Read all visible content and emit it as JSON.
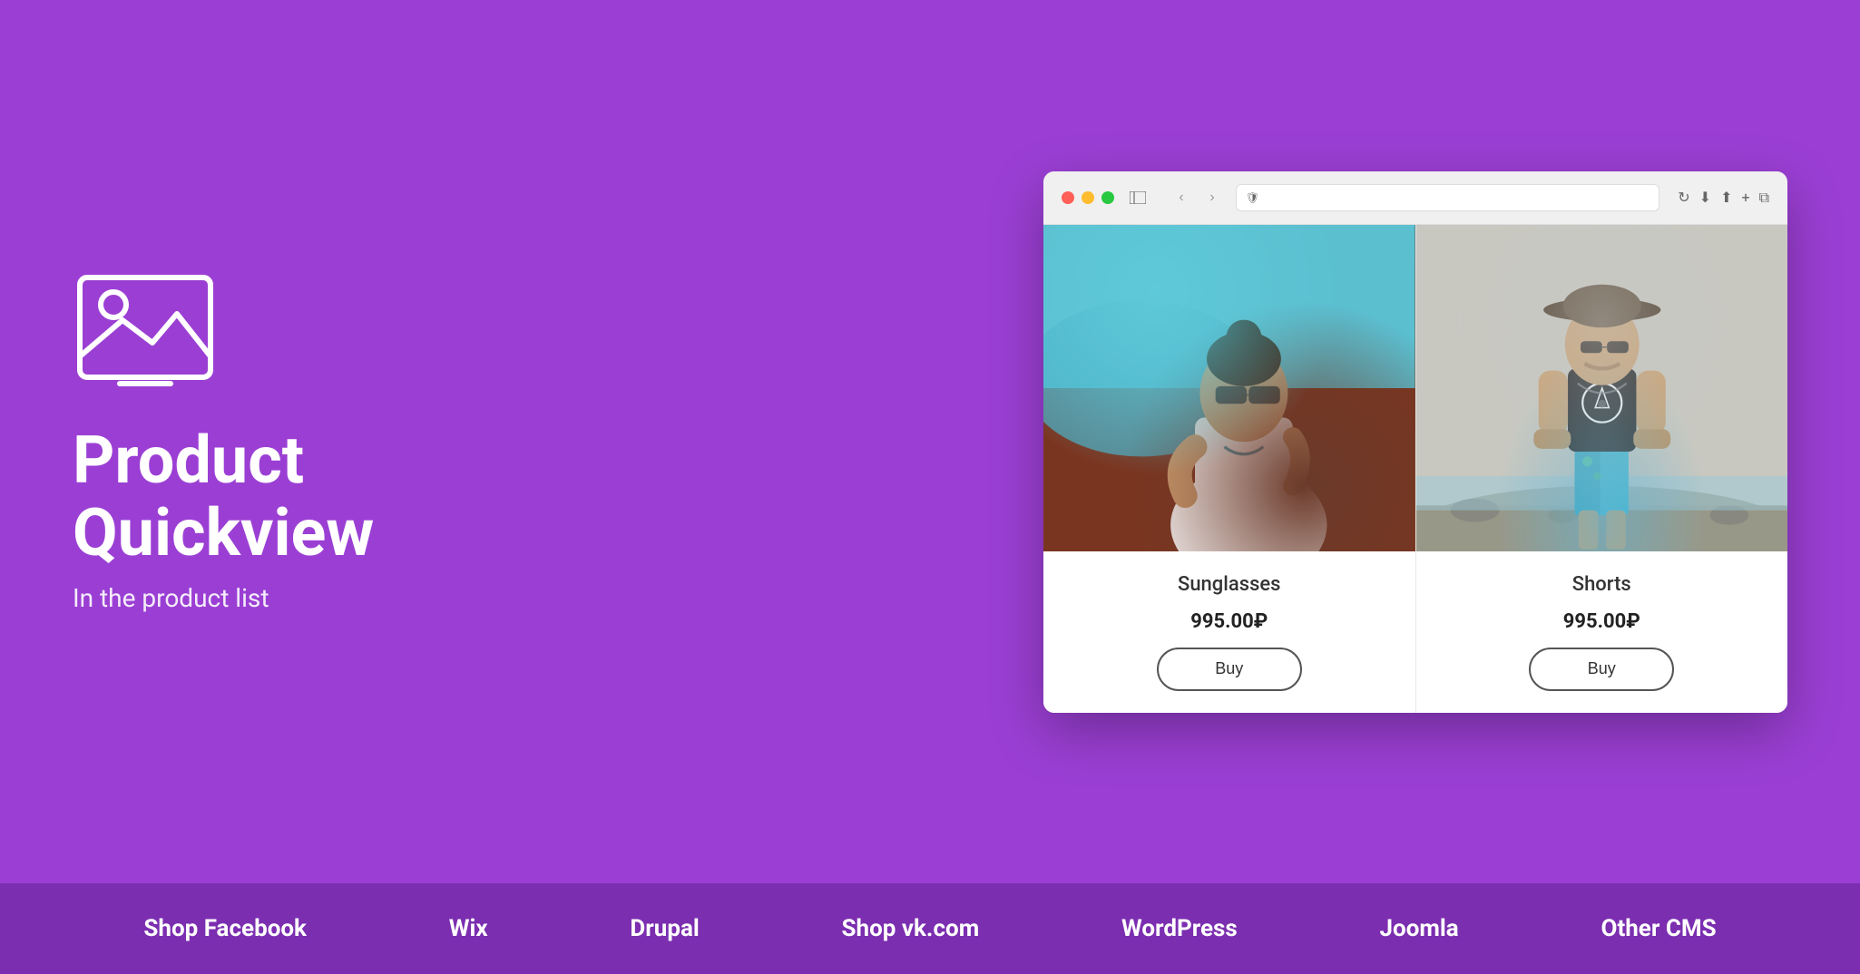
{
  "page": {
    "background_color": "#9b3fd4",
    "footer_background": "#7b2eb0"
  },
  "left_panel": {
    "title": "Product\nQuickview",
    "subtitle": "In the product list",
    "icon_label": "image-placeholder-icon"
  },
  "browser": {
    "toolbar": {
      "address_placeholder": "",
      "nav_back": "‹",
      "nav_forward": "›"
    },
    "products": [
      {
        "id": "sunglasses",
        "name": "Sunglasses",
        "price": "995.00₽",
        "buy_label": "Buy",
        "image_alt": "Woman with sunglasses near car"
      },
      {
        "id": "shorts",
        "name": "Shorts",
        "price": "995.00₽",
        "buy_label": "Buy",
        "image_alt": "Man in black tank top on beach"
      }
    ]
  },
  "footer": {
    "nav_items": [
      {
        "id": "shop-facebook",
        "label": "Shop Facebook"
      },
      {
        "id": "wix",
        "label": "Wix"
      },
      {
        "id": "drupal",
        "label": "Drupal"
      },
      {
        "id": "shop-vkcom",
        "label": "Shop vk.com"
      },
      {
        "id": "wordpress",
        "label": "WordPress"
      },
      {
        "id": "joomla",
        "label": "Joomla"
      },
      {
        "id": "other-cms",
        "label": "Other CMS"
      }
    ]
  }
}
